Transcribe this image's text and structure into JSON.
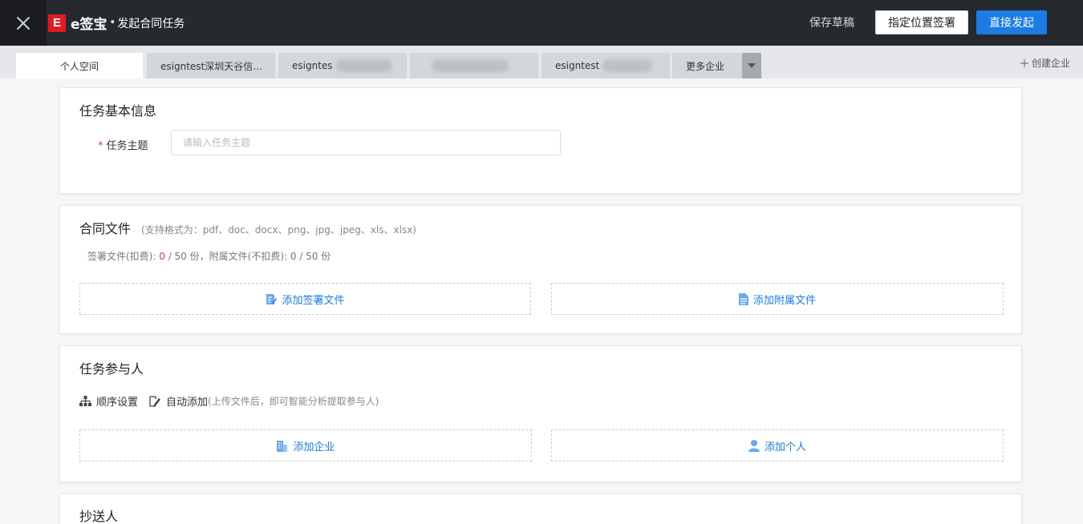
{
  "header": {
    "brand_mark": "E",
    "brand_name": "e签宝",
    "separator": "•",
    "page_title": "发起合同任务",
    "save_draft_label": "保存草稿",
    "locate_sign_label": "指定位置签署",
    "send_label": "直接发起"
  },
  "colors": {
    "accent": "#1a7ce4",
    "brand_red": "#e21a23",
    "header_bg": "#262a2f",
    "required": "#e5383b"
  },
  "tabs": [
    {
      "label": "个人空间",
      "active": true
    },
    {
      "label": "esigntest深圳天谷信…",
      "active": false
    },
    {
      "label": "esigntes",
      "active": false
    },
    {
      "label": "",
      "active": false
    },
    {
      "label": "esigntest",
      "active": false
    }
  ],
  "tab_more_label": "更多企业",
  "create_company_label": "创建企业",
  "basic_info": {
    "title": "任务基本信息",
    "subject_label": "任务主题",
    "subject_placeholder": "请输入任务主题",
    "subject_value": ""
  },
  "contract_files": {
    "title": "合同文件",
    "formats_hint": "(支持格式为：pdf、doc、docx、png、jpg、jpeg、xls、xlsx)",
    "sign_files_label": "签署文件(扣费): ",
    "sign_files_count": "0",
    "sign_files_limit": " / 50 份，",
    "attach_files_label": "附属文件(不扣费): 0 / 50 份",
    "add_sign_file_label": "添加签署文件",
    "add_attach_file_label": "添加附属文件"
  },
  "participants": {
    "title": "任务参与人",
    "order_setting_label": "顺序设置",
    "auto_add_label": "自动添加",
    "auto_add_hint": "(上传文件后，即可智能分析提取参与人)",
    "add_company_label": "添加企业",
    "add_person_label": "添加个人"
  },
  "cc": {
    "title": "抄送人"
  }
}
